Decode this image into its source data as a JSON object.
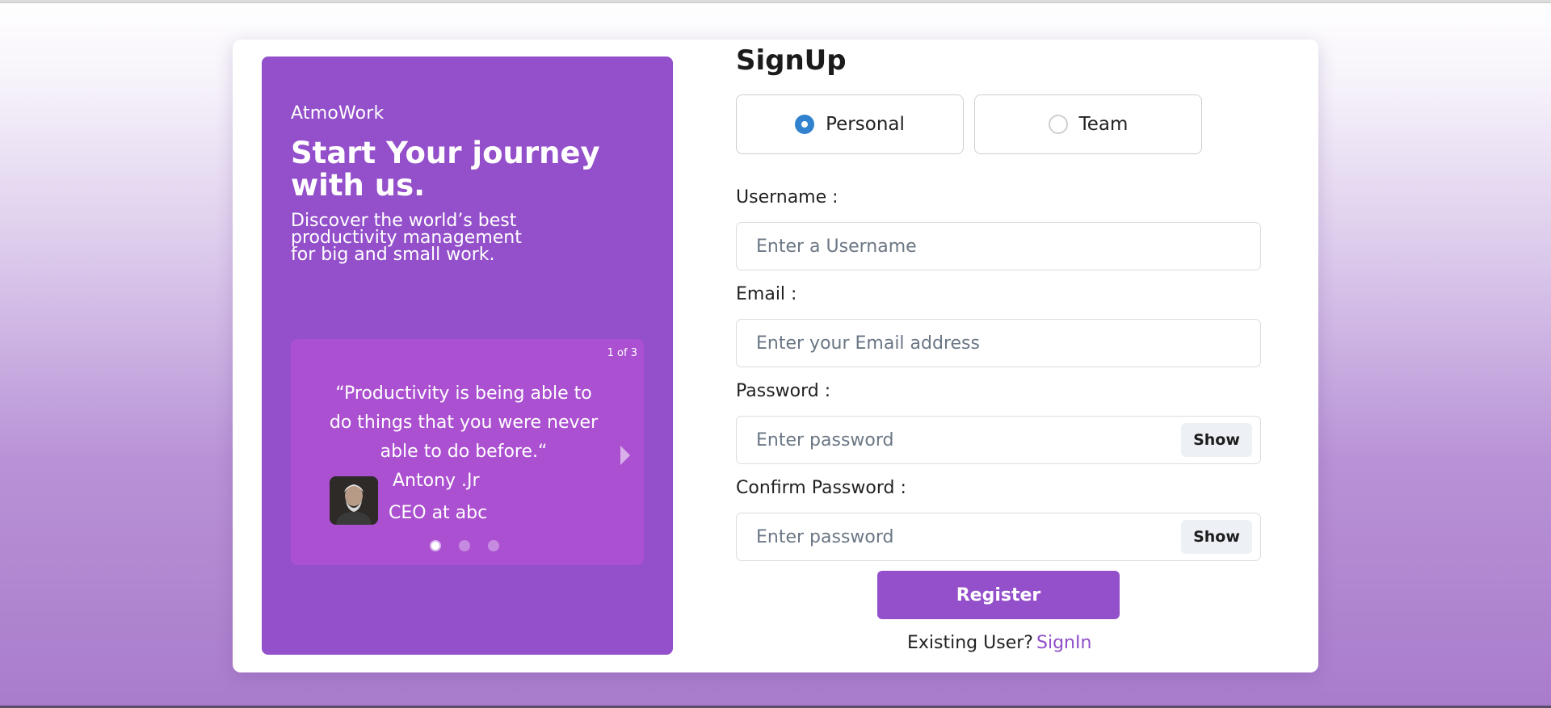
{
  "promo": {
    "brand": "AtmoWork",
    "headline": "Start Your journey with us.",
    "subline": "Discover the world’s best productivity management for big and small work.",
    "carousel": {
      "counter": "1 of 3",
      "quote": "“Productivity is being able to do things that you were never able to do before.“",
      "author": "Antony .Jr",
      "role": "CEO at abc",
      "active_slide": 1,
      "slides_total": 3
    }
  },
  "form": {
    "title": "SignUp",
    "account_types": [
      {
        "label": "Personal",
        "checked": true
      },
      {
        "label": "Team",
        "checked": false
      }
    ],
    "username": {
      "label": "Username :",
      "placeholder": "Enter a Username"
    },
    "email": {
      "label": "Email :",
      "placeholder": "Enter your Email address"
    },
    "password": {
      "label": "Password :",
      "placeholder": "Enter password",
      "toggle": "Show"
    },
    "confirm_password": {
      "label": "Confirm Password :",
      "placeholder": "Enter password",
      "toggle": "Show"
    },
    "register_label": "Register",
    "existing_text": "Existing User?",
    "signin_label": "SignIn"
  },
  "colors": {
    "accent": "#944fcb",
    "quote_bg": "#ab50d0",
    "radio_checked": "#3182ce",
    "link": "#8f4ec9"
  }
}
